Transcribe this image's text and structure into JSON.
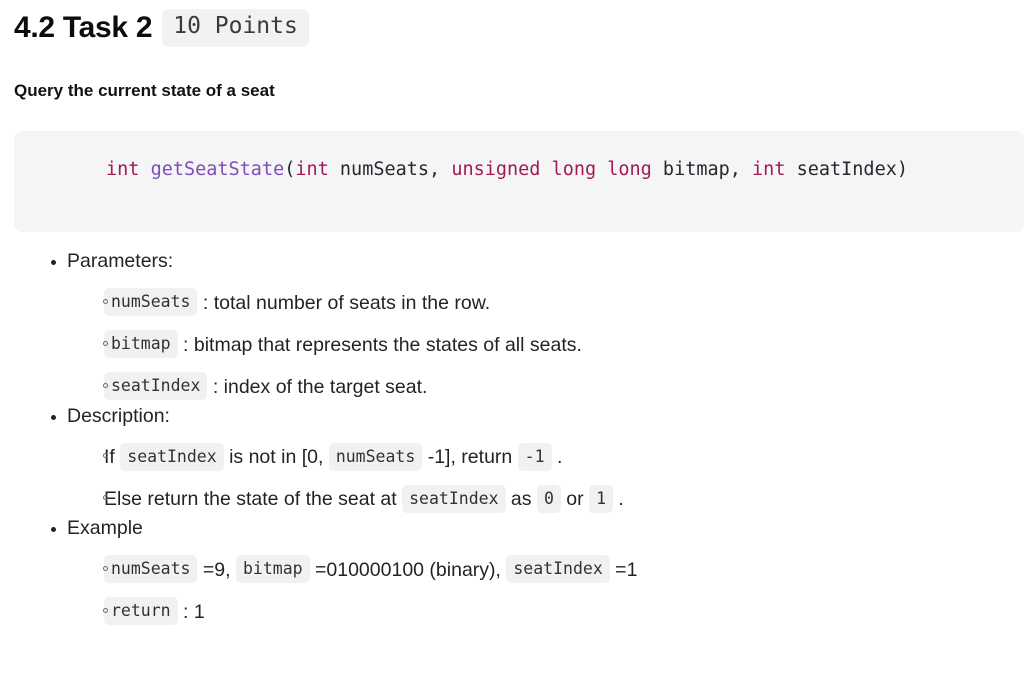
{
  "heading": {
    "title": "4.2 Task 2",
    "points_badge": "10 Points"
  },
  "subheading": "Query the current state of a seat",
  "code_block": {
    "language": "c",
    "tokens": [
      {
        "text": "int",
        "type": "keyword"
      },
      {
        "text": " ",
        "type": "plain"
      },
      {
        "text": "getSeatState",
        "type": "function"
      },
      {
        "text": "(",
        "type": "plain"
      },
      {
        "text": "int",
        "type": "keyword"
      },
      {
        "text": " numSeats, ",
        "type": "plain"
      },
      {
        "text": "unsigned long long",
        "type": "keyword"
      },
      {
        "text": " bitmap, ",
        "type": "plain"
      },
      {
        "text": "int",
        "type": "keyword"
      },
      {
        "text": " seatIndex)",
        "type": "plain"
      }
    ],
    "full_text": "int getSeatState(int numSeats, unsigned long long bitmap, int seatIndex)"
  },
  "colors": {
    "keyword": "#a01a58",
    "function": "#7f4dba",
    "plain": "#24292f",
    "code_block_bg": "#f5f5f5",
    "inline_code_bg": "#f1f1f1",
    "badge_bg": "#f2f2f2",
    "text": "#1f2328"
  },
  "sections": [
    {
      "label": "Parameters:",
      "items": [
        {
          "parts": [
            {
              "t": "code",
              "v": "numSeats"
            },
            {
              "t": "text",
              "v": " : total number of seats in the row."
            }
          ]
        },
        {
          "parts": [
            {
              "t": "code",
              "v": "bitmap"
            },
            {
              "t": "text",
              "v": " : bitmap that represents the states of all seats."
            }
          ]
        },
        {
          "parts": [
            {
              "t": "code",
              "v": "seatIndex"
            },
            {
              "t": "text",
              "v": " : index of the target seat."
            }
          ]
        }
      ]
    },
    {
      "label": "Description:",
      "items": [
        {
          "parts": [
            {
              "t": "text",
              "v": "If "
            },
            {
              "t": "code",
              "v": "seatIndex"
            },
            {
              "t": "text",
              "v": " is not in [0, "
            },
            {
              "t": "code",
              "v": "numSeats"
            },
            {
              "t": "text",
              "v": " -1], return "
            },
            {
              "t": "code",
              "v": "-1"
            },
            {
              "t": "text",
              "v": " ."
            }
          ]
        },
        {
          "parts": [
            {
              "t": "text",
              "v": "Else return the state of the seat at "
            },
            {
              "t": "code",
              "v": "seatIndex"
            },
            {
              "t": "text",
              "v": " as "
            },
            {
              "t": "code",
              "v": "0"
            },
            {
              "t": "text",
              "v": " or "
            },
            {
              "t": "code",
              "v": "1"
            },
            {
              "t": "text",
              "v": " ."
            }
          ]
        }
      ]
    },
    {
      "label": "Example",
      "items": [
        {
          "parts": [
            {
              "t": "code",
              "v": "numSeats"
            },
            {
              "t": "text",
              "v": " =9, "
            },
            {
              "t": "code",
              "v": "bitmap"
            },
            {
              "t": "text",
              "v": " =010000100 (binary), "
            },
            {
              "t": "code",
              "v": "seatIndex"
            },
            {
              "t": "text",
              "v": " =1"
            }
          ]
        },
        {
          "parts": [
            {
              "t": "code",
              "v": "return"
            },
            {
              "t": "text",
              "v": " : 1"
            }
          ]
        }
      ]
    }
  ]
}
